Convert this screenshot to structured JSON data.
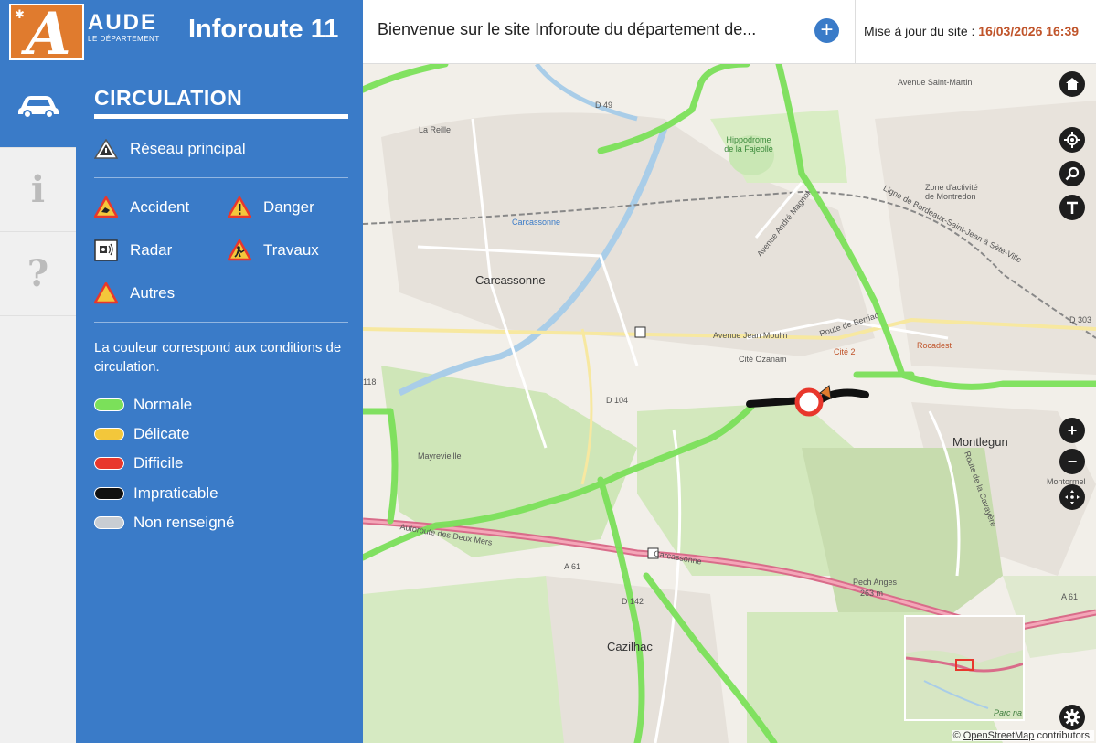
{
  "header": {
    "logo_name": "AUDE",
    "logo_sub": "LE DÉPARTEMENT",
    "app_title": "Inforoute 11",
    "welcome": "Bienvenue sur le site Inforoute du département de...",
    "update_label": "Mise à jour du site :",
    "update_date": "16/03/2026 16:39"
  },
  "sidebar": {
    "items": [
      {
        "icon": "car-icon",
        "active": true
      },
      {
        "icon": "info-icon",
        "glyph": "i",
        "active": false
      },
      {
        "icon": "help-icon",
        "glyph": "?",
        "active": false
      }
    ]
  },
  "legend": {
    "title": "CIRCULATION",
    "main_network": "Réseau principal",
    "events": {
      "accident": "Accident",
      "danger": "Danger",
      "radar": "Radar",
      "travaux": "Travaux",
      "autres": "Autres"
    },
    "note": "La couleur correspond aux conditions de circulation.",
    "conditions": [
      {
        "label": "Normale",
        "color": "#7be05a"
      },
      {
        "label": "Délicate",
        "color": "#f3c73b"
      },
      {
        "label": "Difficile",
        "color": "#e8372c"
      },
      {
        "label": "Impraticable",
        "color": "#111111"
      },
      {
        "label": "Non renseigné",
        "color": "#c8cdd3"
      }
    ]
  },
  "map": {
    "labels": {
      "carcassonne": "Carcassonne",
      "carcassonne_station": "Carcassonne",
      "montlegun": "Montlegun",
      "mayrevieille": "Mayrevieille",
      "cazilhac": "Cazilhac",
      "cite_ozanam": "Cité Ozanam",
      "la_reille": "La Reille",
      "hippodrome": "Hippodrome de la Fajeolle",
      "zone_montredon": "Zone d'activité de Montredon",
      "rocadest": "Rocadest",
      "cite2": "Cité 2",
      "pech_anges": "Pech Anges",
      "pech_alt": "263 m",
      "avenue_jean_moulin": "Avenue Jean Moulin",
      "route_berriac": "Route de Berriac",
      "avenue_saint_martin": "Avenue Saint-Martin",
      "avenue_magnol": "Avenue André Magnol",
      "ligne_bordeaux": "Ligne de Bordeaux-Saint-Jean à Sète-Ville",
      "autoroute": "Autoroute des Deux Mers",
      "a61_1": "A 61",
      "a61_2": "A 61",
      "d49": "D 49",
      "d104": "D 104",
      "d142": "D 142",
      "d303": "D 303",
      "d118": "118",
      "carcassonne_road": "Carcassonne",
      "route_cavayere": "Route de la Cavayère",
      "parc": "Parc na",
      "montormel": "Montormel"
    },
    "controls": {
      "home": "home-icon",
      "locate": "locate-icon",
      "search": "search-icon",
      "measure": "measure-icon",
      "zoom_in": "+",
      "zoom_out": "−",
      "pan": "pan-icon",
      "settings": "gear-icon"
    },
    "attribution_prefix": "©",
    "attribution_link": "OpenStreetMap",
    "attribution_suffix": "contributors."
  }
}
